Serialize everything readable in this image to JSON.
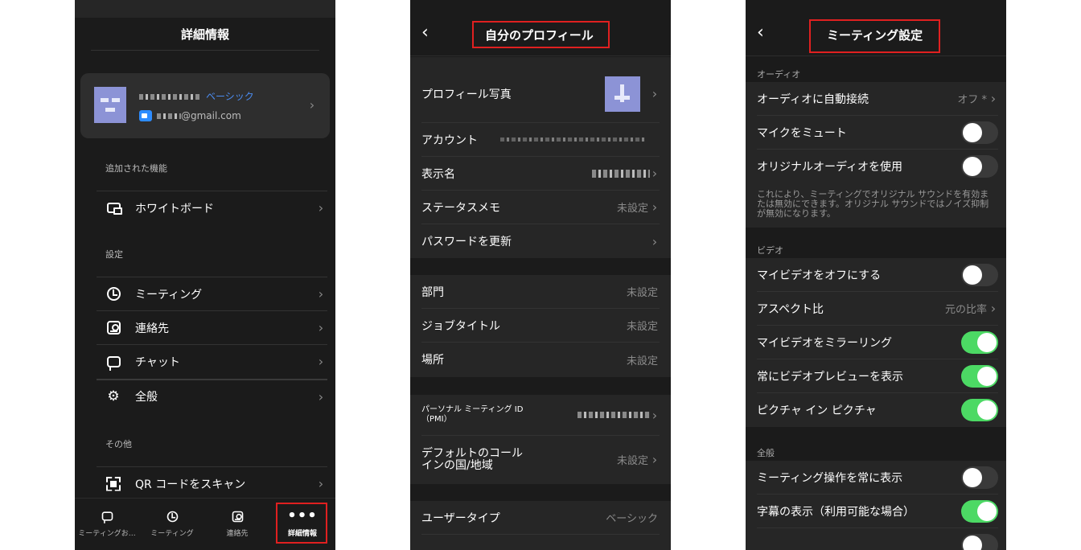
{
  "panel1": {
    "title": "詳細情報",
    "profile": {
      "plan": "ベーシック",
      "email_suffix": "@gmail.com"
    },
    "sections": {
      "features": "追加された機能",
      "settings": "設定",
      "other": "その他"
    },
    "items": {
      "whiteboard": "ホワイトボード",
      "meeting": "ミーティング",
      "contacts": "連絡先",
      "chat": "チャット",
      "general": "全般",
      "qr": "QR コードをスキャン"
    },
    "tabs": [
      "ミーティングお…",
      "ミーティング",
      "連絡先",
      "詳細情報"
    ],
    "active_tab": "詳細情報"
  },
  "panel2": {
    "title": "自分のプロフィール",
    "rows": {
      "photo": "プロフィール写真",
      "account": "アカウント",
      "display_name": "表示名",
      "status": "ステータスメモ",
      "status_value": "未設定",
      "password": "パスワードを更新",
      "department": "部門",
      "department_value": "未設定",
      "job_title": "ジョブタイトル",
      "job_title_value": "未設定",
      "location": "場所",
      "location_value": "未設定",
      "pmi_line1": "パーソナル ミーティング ID",
      "pmi_line2": "（PMI）",
      "callin_line1": "デフォルトのコール",
      "callin_line2": "インの国/地域",
      "callin_value": "未設定",
      "user_type": "ユーザータイプ",
      "user_type_value": "ベーシック"
    }
  },
  "panel3": {
    "title": "ミーティング設定",
    "sections": {
      "audio": "オーディオ",
      "video": "ビデオ",
      "general": "全般"
    },
    "rows": {
      "auto_connect": "オーディオに自動接続",
      "auto_connect_value": "オフ *",
      "mute_mic": "マイクをミュート",
      "original_audio": "オリジナルオーディオを使用",
      "note": "これにより、ミーティングでオリジナル サウンドを有効または無効にできます。オリジナル サウンドではノイズ抑制が無効になります。",
      "video_off": "マイビデオをオフにする",
      "aspect": "アスペクト比",
      "aspect_value": "元の比率",
      "mirror": "マイビデオをミラーリング",
      "preview": "常にビデオプレビューを表示",
      "pip": "ピクチャ イン ピクチャ",
      "always_controls": "ミーティング操作を常に表示",
      "captions": "字幕の表示（利用可能な場合）"
    },
    "toggles": {
      "mute_mic": false,
      "original_audio": false,
      "video_off": false,
      "mirror": true,
      "preview": true,
      "pip": true,
      "always_controls": false,
      "captions": true
    }
  },
  "colors": {
    "highlight": "#e02020",
    "toggle_on": "#4cd964",
    "link": "#4b8cf0",
    "background": "#1b1b1b"
  }
}
